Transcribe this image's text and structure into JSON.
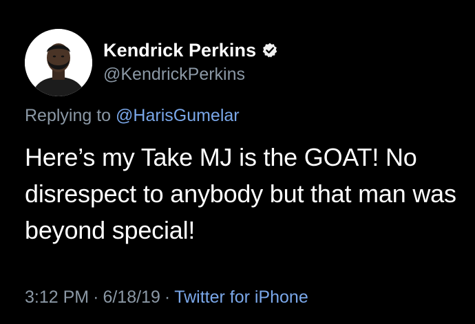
{
  "tweet": {
    "display_name": "Kendrick Perkins",
    "handle": "@KendrickPerkins",
    "verified": true,
    "reply_prefix": "Replying to",
    "reply_to": "@HarisGumelar",
    "text": "Here’s my Take MJ is the GOAT! No disrespect to anybody but that man was beyond special!",
    "time": "3:12 PM",
    "date": "6/18/19",
    "separator": "·",
    "source": "Twitter for iPhone"
  },
  "icons": {
    "avatar": "profile-photo",
    "verified": "verified-badge-icon"
  },
  "colors": {
    "background": "#000000",
    "text": "#ffffff",
    "secondary": "#8b98a5",
    "link": "#7aa7e9"
  }
}
